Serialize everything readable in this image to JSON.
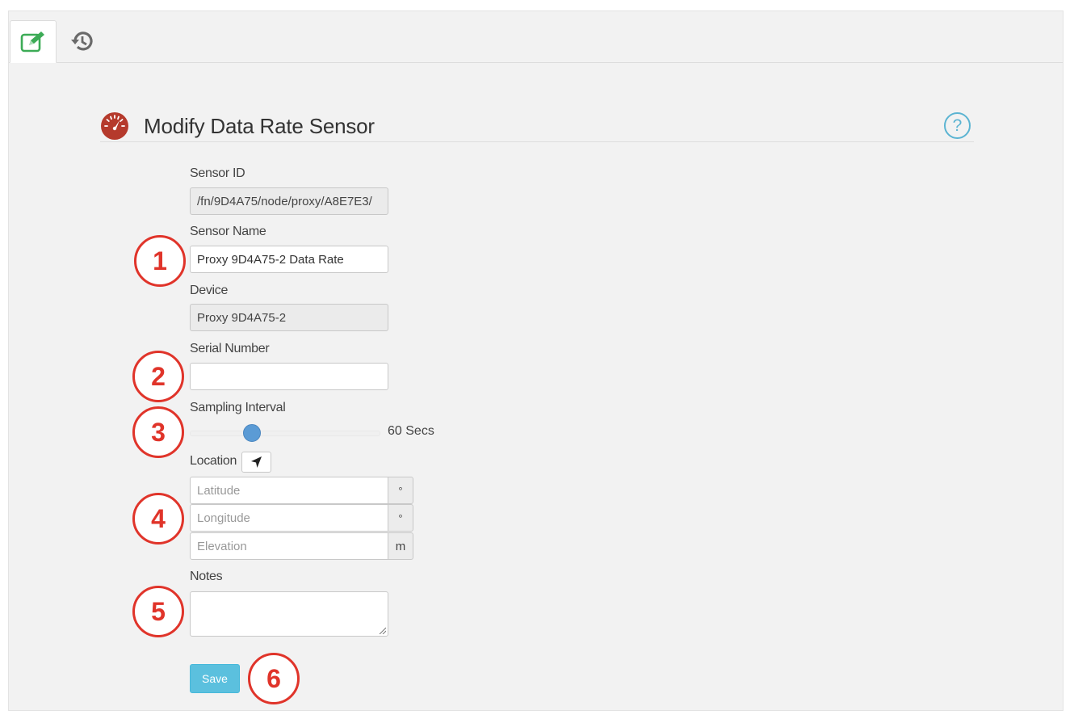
{
  "tabs": [
    {
      "icon": "edit-icon",
      "active": true
    },
    {
      "icon": "history-icon",
      "active": false
    }
  ],
  "header": {
    "title": "Modify Data Rate Sensor",
    "gauge_icon": "gauge-icon",
    "help_icon": "help-icon",
    "help_glyph": "?"
  },
  "form": {
    "sensor_id": {
      "label": "Sensor ID",
      "value": "/fn/9D4A75/node/proxy/A8E7E3/"
    },
    "sensor_name": {
      "label": "Sensor Name",
      "value": "Proxy 9D4A75-2 Data Rate"
    },
    "device": {
      "label": "Device",
      "value": "Proxy 9D4A75-2"
    },
    "serial_number": {
      "label": "Serial Number",
      "value": ""
    },
    "sampling_interval": {
      "label": "Sampling Interval",
      "value_text": "60 Secs",
      "position_fraction": 0.33
    },
    "location": {
      "label": "Location",
      "locate_icon": "location-arrow-icon",
      "latitude": {
        "placeholder": "Latitude",
        "unit": "°"
      },
      "longitude": {
        "placeholder": "Longitude",
        "unit": "°"
      },
      "elevation": {
        "placeholder": "Elevation",
        "unit": "m"
      }
    },
    "notes": {
      "label": "Notes",
      "value": ""
    },
    "save_label": "Save"
  },
  "annotations": [
    "1",
    "2",
    "3",
    "4",
    "5",
    "6"
  ],
  "colors": {
    "accent": "#5bc0de",
    "edit_icon": "#3cab56",
    "gauge": "#b53a2c",
    "annotation": "#e0342a",
    "slider_thumb": "#5b9bd5"
  }
}
